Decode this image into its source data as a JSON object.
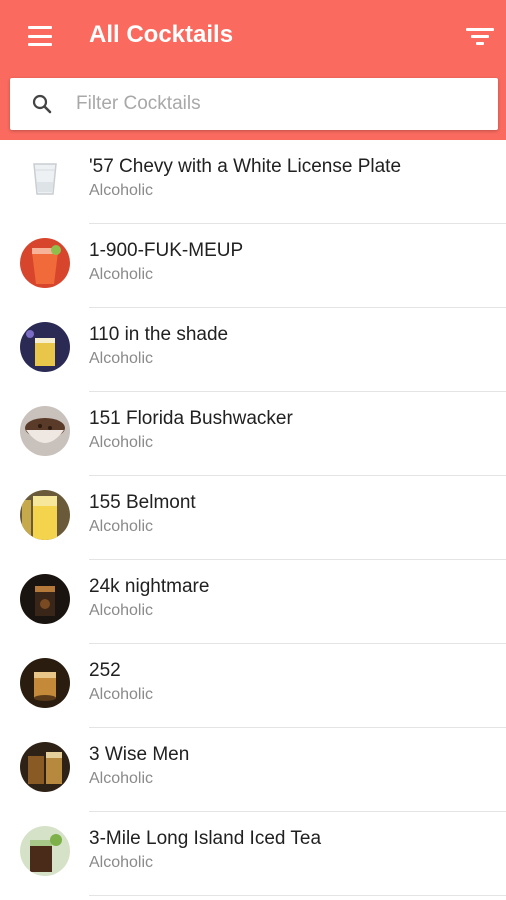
{
  "app": {
    "title": "All Cocktails",
    "accent_color": "#fa6a5f"
  },
  "toolbar": {
    "menu_icon": "hamburger-menu-icon",
    "filter_icon": "filter-icon"
  },
  "search": {
    "placeholder": "Filter Cocktails",
    "value": "",
    "icon": "search-icon"
  },
  "cocktails": [
    {
      "name": "'57 Chevy with a White License Plate",
      "category": "Alcoholic"
    },
    {
      "name": "1-900-FUK-MEUP",
      "category": "Alcoholic"
    },
    {
      "name": "110 in the shade",
      "category": "Alcoholic"
    },
    {
      "name": "151 Florida Bushwacker",
      "category": "Alcoholic"
    },
    {
      "name": "155 Belmont",
      "category": "Alcoholic"
    },
    {
      "name": "24k nightmare",
      "category": "Alcoholic"
    },
    {
      "name": "252",
      "category": "Alcoholic"
    },
    {
      "name": "3 Wise Men",
      "category": "Alcoholic"
    },
    {
      "name": "3-Mile Long Island Iced Tea",
      "category": "Alcoholic"
    }
  ]
}
